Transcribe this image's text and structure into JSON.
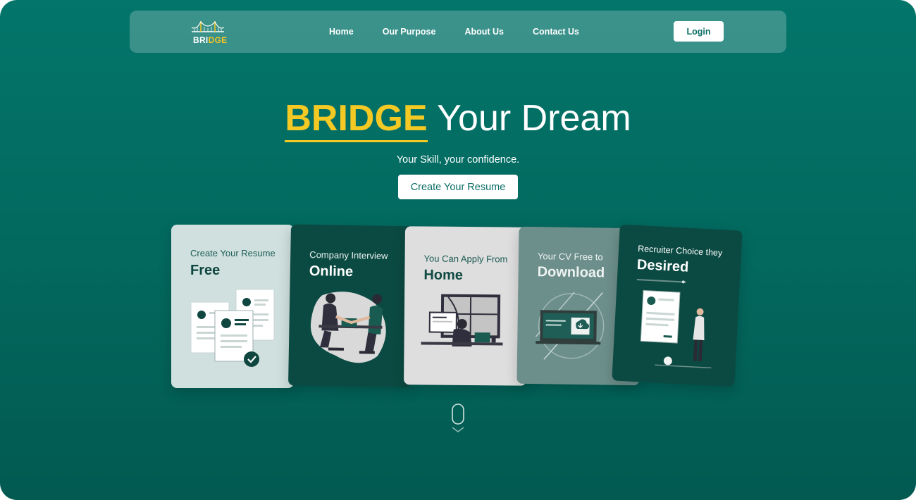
{
  "brand": {
    "logo_part1": "BRI",
    "logo_part2": "DGE"
  },
  "nav": {
    "links": [
      "Home",
      "Our Purpose",
      "About Us",
      "Contact Us"
    ],
    "login_label": "Login"
  },
  "hero": {
    "title_highlight": "BRIDGE",
    "title_rest": "Your Dream",
    "subtitle": "Your Skill, your confidence.",
    "cta_label": "Create Your Resume"
  },
  "cards": [
    {
      "small": "Create Your Resume",
      "big": "Free"
    },
    {
      "small": "Company Interview",
      "big": "Online"
    },
    {
      "small": "You Can Apply From",
      "big": "Home"
    },
    {
      "small": "Your CV Free to",
      "big": "Download"
    },
    {
      "small": "Recruiter Choice they",
      "big": "Desired"
    }
  ],
  "colors": {
    "background": "#036a60",
    "accent_yellow": "#f4c924",
    "dark_card": "#0b4a42"
  },
  "icons": [
    "bridge-logo-icon",
    "scroll-down-icon",
    "chevron-down-icon"
  ]
}
